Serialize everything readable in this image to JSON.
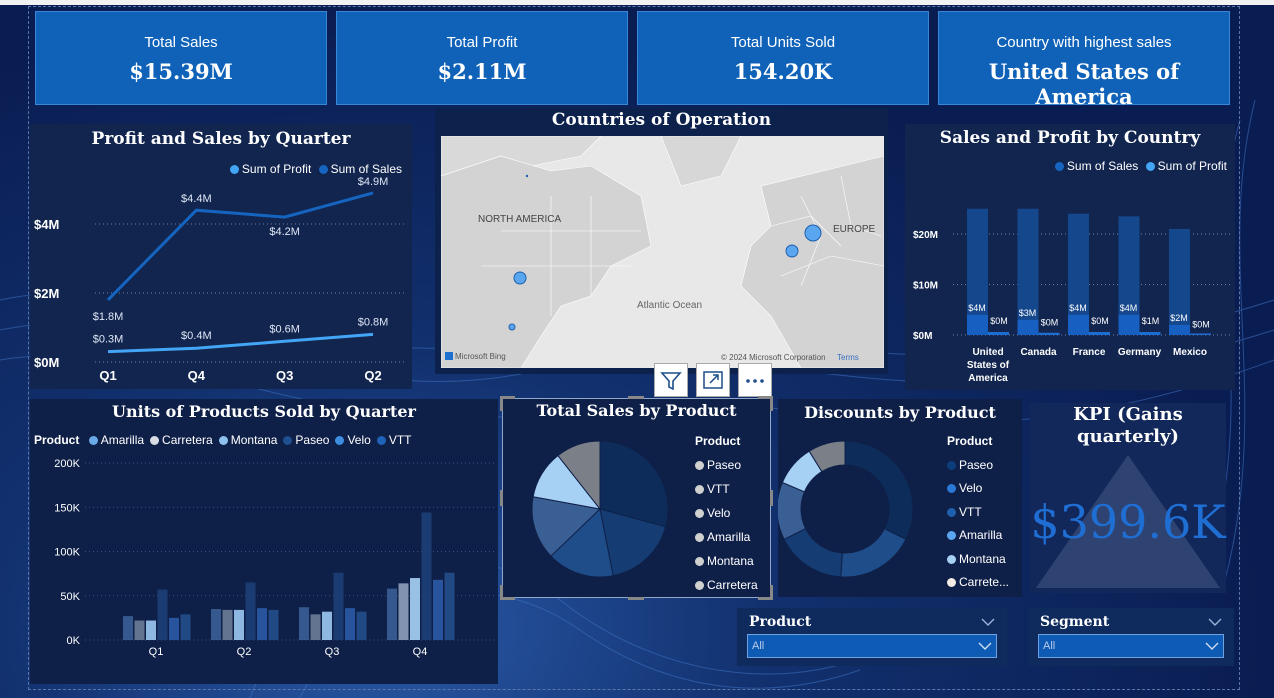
{
  "kpis": [
    {
      "label": "Total Sales",
      "value": "$15.39M"
    },
    {
      "label": "Total Profit",
      "value": "$2.11M"
    },
    {
      "label": "Total Units Sold",
      "value": "154.20K"
    },
    {
      "label": "Country with highest sales",
      "value": "United States of America"
    }
  ],
  "profit_sales_quarter": {
    "title": "Profit and Sales by Quarter",
    "legend": [
      "Sum of Profit",
      "Sum of  Sales"
    ],
    "yticks": [
      "$4M",
      "$2M",
      "$0M"
    ],
    "categories": [
      "Q1",
      "Q4",
      "Q3",
      "Q2"
    ],
    "sales": [
      1.8,
      4.4,
      4.2,
      4.9
    ],
    "profit": [
      0.3,
      0.4,
      0.6,
      0.8
    ],
    "sales_labels": [
      "$1.8M",
      "$4.4M",
      "$4.2M",
      "$4.9M"
    ],
    "profit_labels": [
      "$0.3M",
      "$0.4M",
      "$0.6M",
      "$0.8M"
    ]
  },
  "map": {
    "title": "Countries of Operation",
    "labels": {
      "na": "NORTH AMERICA",
      "eu": "EUROPE",
      "ocean": "Atlantic Ocean",
      "bing": "Microsoft Bing",
      "copyright": "© 2024 Microsoft Corporation",
      "terms": "Terms"
    }
  },
  "sales_profit_country": {
    "title": "Sales and Profit by Country",
    "legend": [
      "Sum of  Sales",
      "Sum of Profit"
    ],
    "yticks": [
      "$20M",
      "$10M",
      "$0M"
    ],
    "countries": [
      "United States of America",
      "Canada",
      "France",
      "Germany",
      "Mexico"
    ],
    "sales": [
      25,
      25,
      24,
      23.5,
      21
    ],
    "profit": [
      4,
      3,
      4,
      4,
      2
    ],
    "sales_labels": [
      "$0M",
      "$0M",
      "$0M",
      "$1M",
      "$0M"
    ],
    "profit_labels": [
      "$4M",
      "$3M",
      "$4M",
      "$4M",
      "$2M"
    ]
  },
  "units_quarter": {
    "title": "Units of Products Sold by Quarter",
    "legend_title": "Product",
    "products": [
      "Amarilla",
      "Carretera",
      "Montana",
      "Paseo",
      "Velo",
      "VTT"
    ],
    "yticks": [
      "200K",
      "150K",
      "100K",
      "50K",
      "0K"
    ],
    "quarters": [
      "Q1",
      "Q2",
      "Q3",
      "Q4"
    ],
    "values": [
      [
        27,
        22,
        22,
        57,
        25,
        29
      ],
      [
        35,
        34,
        34,
        65,
        36,
        34
      ],
      [
        37,
        29,
        32,
        76,
        36,
        32
      ],
      [
        58,
        64,
        70,
        144,
        68,
        76
      ]
    ]
  },
  "total_sales_product": {
    "title": "Total Sales by Product",
    "legend_title": "Product",
    "items": [
      "Paseo",
      "VTT",
      "Velo",
      "Amarilla",
      "Montana",
      "Carretera"
    ],
    "values": [
      33,
      20,
      18,
      17,
      13,
      12
    ]
  },
  "discounts_product": {
    "title": "Discounts by Product",
    "legend_title": "Product",
    "items": [
      "Paseo",
      "Velo",
      "VTT",
      "Amarilla",
      "Montana",
      "Carrete..."
    ],
    "values": [
      33,
      19,
      17,
      14,
      10,
      9
    ]
  },
  "kpi_gains": {
    "title": "KPI (Gains quarterly)",
    "value": "$399.6K"
  },
  "slicers": [
    {
      "label": "Product",
      "value": "All"
    },
    {
      "label": "Segment",
      "value": "All"
    }
  ],
  "colors": {
    "kpi_bg": "#0f62b8",
    "panel": "#11254f",
    "sales_line": "#1565c0",
    "profit_line": "#42a5f5"
  }
}
